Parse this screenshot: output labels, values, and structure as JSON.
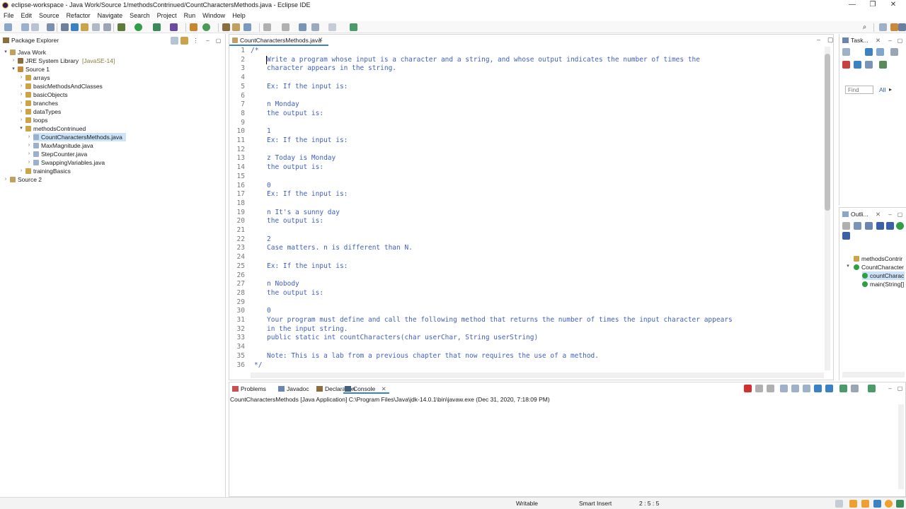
{
  "window": {
    "title": "eclipse-workspace - Java Work/Source 1/methodsContrinued/CountCharactersMethods.java - Eclipse IDE",
    "controls": {
      "minimize": "—",
      "restore": "❐",
      "close": "✕"
    }
  },
  "menu": [
    "File",
    "Edit",
    "Source",
    "Refactor",
    "Navigate",
    "Search",
    "Project",
    "Run",
    "Window",
    "Help"
  ],
  "package_explorer": {
    "tab_label": "Package Explorer",
    "tree": [
      {
        "label": "Java Work",
        "level": 0,
        "expanded": true,
        "type": "project"
      },
      {
        "label": "JRE System Library",
        "suffix": "[JavaSE-14]",
        "level": 1,
        "expanded": false,
        "type": "library"
      },
      {
        "label": "Source 1",
        "level": 1,
        "expanded": true,
        "type": "srcfolder"
      },
      {
        "label": "arrays",
        "level": 2,
        "expanded": false,
        "type": "package"
      },
      {
        "label": "basicMethodsAndClasses",
        "level": 2,
        "expanded": false,
        "type": "package"
      },
      {
        "label": "basicObjects",
        "level": 2,
        "expanded": false,
        "type": "package"
      },
      {
        "label": "branches",
        "level": 2,
        "expanded": false,
        "type": "package"
      },
      {
        "label": "dataTypes",
        "level": 2,
        "expanded": false,
        "type": "package"
      },
      {
        "label": "loops",
        "level": 2,
        "expanded": false,
        "type": "package"
      },
      {
        "label": "methodsContrinued",
        "level": 2,
        "expanded": true,
        "type": "package"
      },
      {
        "label": "CountCharactersMethods.java",
        "level": 3,
        "expanded": false,
        "type": "java",
        "selected": true
      },
      {
        "label": "MaxMagnitude.java",
        "level": 3,
        "expanded": false,
        "type": "java"
      },
      {
        "label": "StepCounter.java",
        "level": 3,
        "expanded": false,
        "type": "java"
      },
      {
        "label": "SwappingVariables.java",
        "level": 3,
        "expanded": false,
        "type": "java"
      },
      {
        "label": "trainingBasics",
        "level": 2,
        "expanded": false,
        "type": "package"
      },
      {
        "label": "Source 2",
        "level": 0,
        "expanded": false,
        "type": "project"
      }
    ]
  },
  "editor": {
    "tab_label": "CountCharactersMethods.java",
    "lines": [
      {
        "n": "1",
        "text": "/*"
      },
      {
        "n": "2",
        "text": "Write a program whose input is a character and a string, and whose output indicates the number of times the"
      },
      {
        "n": "3",
        "text": "character appears in the string."
      },
      {
        "n": "4",
        "text": ""
      },
      {
        "n": "5",
        "text": "Ex: If the input is:"
      },
      {
        "n": "6",
        "text": ""
      },
      {
        "n": "7",
        "text": "n Monday"
      },
      {
        "n": "8",
        "text": "the output is:"
      },
      {
        "n": "9",
        "text": ""
      },
      {
        "n": "10",
        "text": "1"
      },
      {
        "n": "11",
        "text": "Ex: If the input is:"
      },
      {
        "n": "12",
        "text": ""
      },
      {
        "n": "13",
        "text": "z Today is Monday"
      },
      {
        "n": "14",
        "text": "the output is:"
      },
      {
        "n": "15",
        "text": ""
      },
      {
        "n": "16",
        "text": "0"
      },
      {
        "n": "17",
        "text": "Ex: If the input is:"
      },
      {
        "n": "18",
        "text": ""
      },
      {
        "n": "19",
        "text": "n It's a sunny day"
      },
      {
        "n": "20",
        "text": "the output is:"
      },
      {
        "n": "21",
        "text": ""
      },
      {
        "n": "22",
        "text": "2"
      },
      {
        "n": "23",
        "text": "Case matters. n is different than N."
      },
      {
        "n": "24",
        "text": ""
      },
      {
        "n": "25",
        "text": "Ex: If the input is:"
      },
      {
        "n": "26",
        "text": ""
      },
      {
        "n": "27",
        "text": "n Nobody"
      },
      {
        "n": "28",
        "text": "the output is:"
      },
      {
        "n": "29",
        "text": ""
      },
      {
        "n": "30",
        "text": "0"
      },
      {
        "n": "31",
        "text": "Your program must define and call the following method that returns the number of times the input character appears"
      },
      {
        "n": "32",
        "text": "in the input string."
      },
      {
        "n": "33",
        "text": "public static int countCharacters(char userChar, String userString)"
      },
      {
        "n": "34",
        "text": ""
      },
      {
        "n": "35",
        "text": "Note: This is a lab from a previous chapter that now requires the use of a method."
      },
      {
        "n": "36",
        "text": "*/"
      }
    ]
  },
  "task_panel": {
    "tab_label": "Task...",
    "find_placeholder": "Find",
    "all_label": "All"
  },
  "outline_panel": {
    "tab_label": "Outli...",
    "items": [
      {
        "label": "methodsContrir",
        "level": 0
      },
      {
        "label": "CountCharacter",
        "level": 0
      },
      {
        "label": "countCharac",
        "level": 1,
        "selected": true
      },
      {
        "label": "main(String[]",
        "level": 1
      }
    ]
  },
  "console": {
    "tabs": [
      "Problems",
      "Javadoc",
      "Declaration",
      "Console"
    ],
    "active_tab": "Console",
    "launch_info": "CountCharactersMethods [Java Application] C:\\Program Files\\Java\\jdk-14.0.1\\bin\\javaw.exe  (Dec 31, 2020, 7:18:09 PM)"
  },
  "status": {
    "writable": "Writable",
    "insert_mode": "Smart Insert",
    "position": "2 : 5 : 5"
  },
  "colors": {
    "comment": "#3f5fbf",
    "keyword": "#7f0055",
    "selection": "#cde3f7",
    "accent": "#3b82c4"
  }
}
